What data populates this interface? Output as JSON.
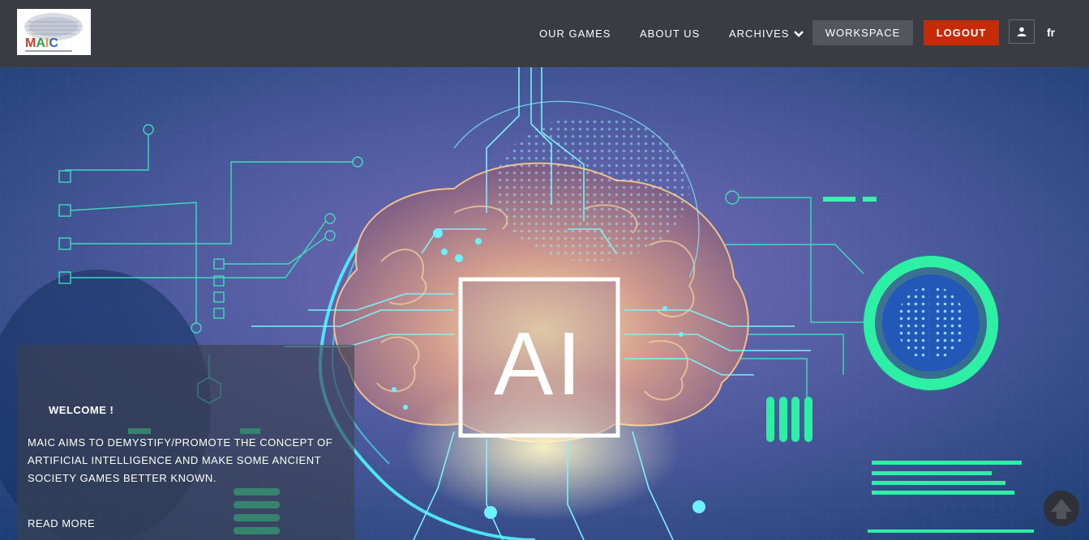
{
  "logo": {
    "alt_text": "MAIC"
  },
  "nav": {
    "our_games": "OUR GAMES",
    "about_us": "ABOUT US",
    "archives": "ARCHIVES",
    "workspace": "WORKSPACE",
    "logout": "LOGOUT",
    "user_icon": "user-icon",
    "language": "fr"
  },
  "hero": {
    "badge_text": "AI",
    "welcome_title": "WELCOME !",
    "welcome_text": "MAIC AIMS TO DEMYSTIFY/PROMOTE THE CONCEPT OF ARTIFICIAL INTELLIGENCE AND MAKE SOME ANCIENT SOCIETY GAMES BETTER KNOWN.",
    "read_more": "READ MORE"
  },
  "colors": {
    "header_bg": "#3a3b43",
    "workspace_bg": "#54565d",
    "logout_bg": "#c62a09",
    "accent_cyan": "#3fe0ff",
    "accent_green": "#2cf0a8"
  }
}
